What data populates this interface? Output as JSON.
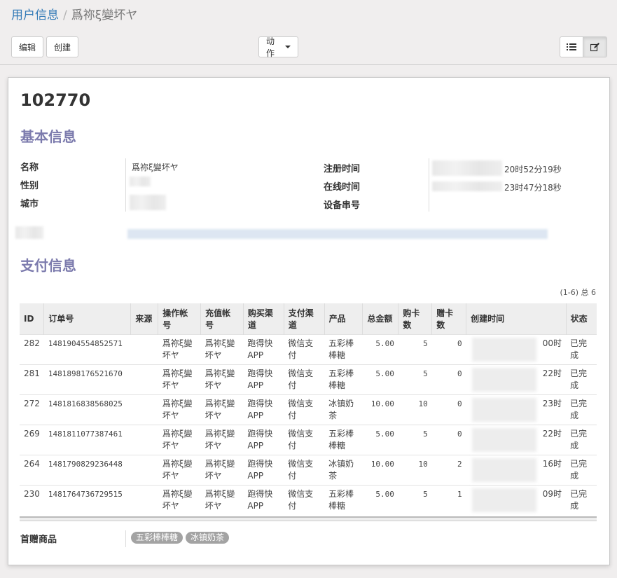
{
  "breadcrumb": {
    "parent": "用户信息",
    "separator": "/",
    "current": "爲祢ξ變坏ヤ"
  },
  "toolbar": {
    "edit_label": "编辑",
    "create_label": "创建",
    "action_label": "动作"
  },
  "record": {
    "id": "102770"
  },
  "basic": {
    "title": "基本信息",
    "name_label": "名称",
    "name_value": "爲祢ξ變坏ヤ",
    "gender_label": "性别",
    "city_label": "城市",
    "reg_time_label": "注册时间",
    "reg_time_value": "20时52分19秒",
    "online_time_label": "在线时间",
    "online_time_value": "23时47分18秒",
    "device_label": "设备串号"
  },
  "payment": {
    "title": "支付信息",
    "pager": "(1-6) 总 6",
    "headers": [
      "ID",
      "订单号",
      "来源",
      "操作帐号",
      "充值帐号",
      "购买渠道",
      "支付渠道",
      "产品",
      "总金额",
      "购卡数",
      "赠卡数",
      "创建时间",
      "状态"
    ],
    "rows": [
      {
        "id": "282",
        "order": "1481904554852571",
        "source": "",
        "op": "爲祢ξ變坏ヤ",
        "recharge": "爲祢ξ變坏ヤ",
        "buy": "跑得快APP",
        "pay": "微信支付",
        "product": "五彩棒棒糖",
        "total": "5.00",
        "cards": "5",
        "gift": "0",
        "created": "00时",
        "status": "已完成"
      },
      {
        "id": "281",
        "order": "1481898176521670",
        "source": "",
        "op": "爲祢ξ變坏ヤ",
        "recharge": "爲祢ξ變坏ヤ",
        "buy": "跑得快APP",
        "pay": "微信支付",
        "product": "五彩棒棒糖",
        "total": "5.00",
        "cards": "5",
        "gift": "0",
        "created": "22时",
        "status": "已完成"
      },
      {
        "id": "272",
        "order": "1481816838568025",
        "source": "",
        "op": "爲祢ξ變坏ヤ",
        "recharge": "爲祢ξ變坏ヤ",
        "buy": "跑得快APP",
        "pay": "微信支付",
        "product": "冰镇奶茶",
        "total": "10.00",
        "cards": "10",
        "gift": "0",
        "created": "23时",
        "status": "已完成"
      },
      {
        "id": "269",
        "order": "1481811077387461",
        "source": "",
        "op": "爲祢ξ變坏ヤ",
        "recharge": "爲祢ξ變坏ヤ",
        "buy": "跑得快APP",
        "pay": "微信支付",
        "product": "五彩棒棒糖",
        "total": "5.00",
        "cards": "5",
        "gift": "0",
        "created": "22时",
        "status": "已完成"
      },
      {
        "id": "264",
        "order": "1481790829236448",
        "source": "",
        "op": "爲祢ξ變坏ヤ",
        "recharge": "爲祢ξ變坏ヤ",
        "buy": "跑得快APP",
        "pay": "微信支付",
        "product": "冰镇奶茶",
        "total": "10.00",
        "cards": "10",
        "gift": "2",
        "created": "16时",
        "status": "已完成"
      },
      {
        "id": "230",
        "order": "1481764736729515",
        "source": "",
        "op": "爲祢ξ變坏ヤ",
        "recharge": "爲祢ξ變坏ヤ",
        "buy": "跑得快APP",
        "pay": "微信支付",
        "product": "五彩棒棒糖",
        "total": "5.00",
        "cards": "5",
        "gift": "1",
        "created": "09时",
        "status": "已完成"
      }
    ]
  },
  "first_gift": {
    "label": "首赠商品",
    "tags": [
      "五彩棒棒糖",
      "冰镇奶茶"
    ]
  },
  "icons": {
    "list_view": "list-icon",
    "form_view": "edit-icon"
  }
}
